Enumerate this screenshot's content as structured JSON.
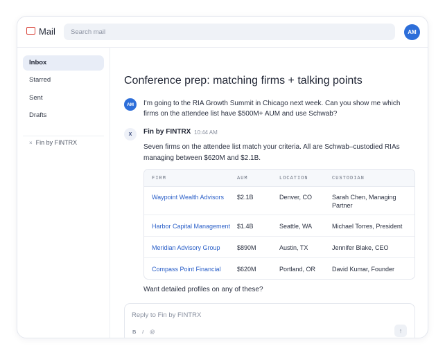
{
  "app": {
    "title": "Mail",
    "search_placeholder": "Search mail",
    "user_initials": "AM"
  },
  "sidebar": {
    "items": [
      {
        "label": "Inbox",
        "active": true
      },
      {
        "label": "Starred"
      },
      {
        "label": "Sent"
      },
      {
        "label": "Drafts"
      }
    ],
    "contact": {
      "close_glyph": "×",
      "label": "Fin by FINTRX"
    }
  },
  "thread": {
    "subject": "Conference prep: matching firms + talking points",
    "user_message": {
      "avatar": "AM",
      "text": "I'm going to the RIA Growth Summit in Chicago next week. Can you show me which firms on the attendee list have $500M+ AUM and use Schwab?"
    },
    "bot_message": {
      "avatar": "X",
      "sender": "Fin by FINTRX",
      "time": "10:44 AM",
      "intro": "Seven firms on the attendee list match your criteria. All are Schwab–custodied RIAs managing between $620M and $2.1B.",
      "closing": "Want detailed profiles on any of these?"
    }
  },
  "table": {
    "headers": {
      "firm": "FIRM",
      "aum": "AUM",
      "location": "LOCATION",
      "custodian": "CUSTODIAN"
    },
    "rows": [
      {
        "firm": "Waypoint Wealth Advisors",
        "aum": "$2.1B",
        "location": "Denver, CO",
        "custodian": "Sarah Chen, Managing Partner"
      },
      {
        "firm": "Harbor Capital Management",
        "aum": "$1.4B",
        "location": "Seattle, WA",
        "custodian": "Michael Torres, President"
      },
      {
        "firm": "Meridian Advisory Group",
        "aum": "$890M",
        "location": "Austin, TX",
        "custodian": "Jennifer Blake, CEO"
      },
      {
        "firm": "Compass Point Financial",
        "aum": "$620M",
        "location": "Portland, OR",
        "custodian": "David Kumar, Founder"
      }
    ]
  },
  "reply": {
    "placeholder": "Reply to Fin by FINTRX",
    "bold": "B",
    "italic": "I",
    "mention": "@",
    "send_glyph": "↑"
  },
  "colors": {
    "accent": "#2d6ed9",
    "link": "#2a5fc8",
    "logo": "#d9443a",
    "active_nav": "#e8edf7"
  }
}
